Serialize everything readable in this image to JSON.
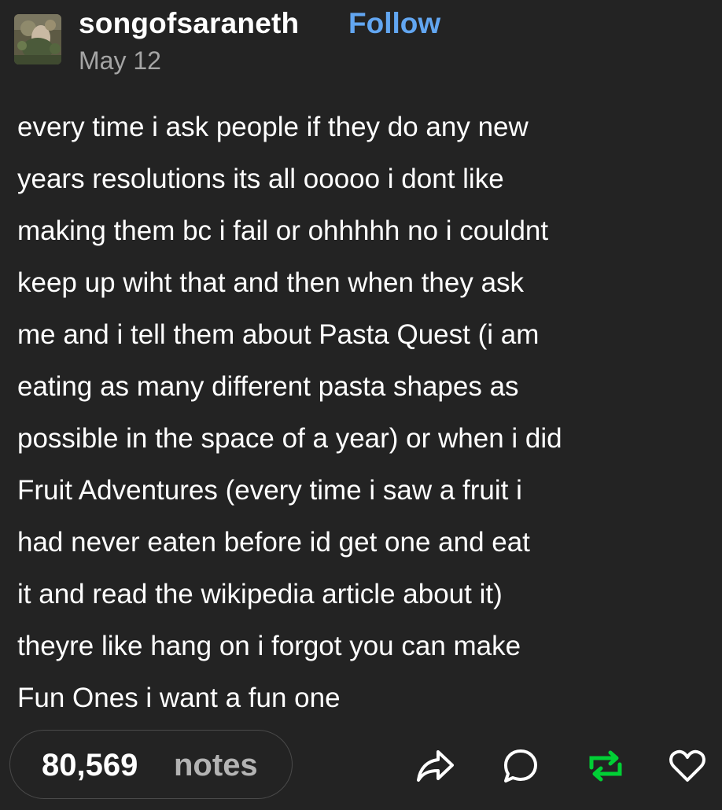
{
  "post": {
    "username": "songofsaraneth",
    "follow_label": "Follow",
    "date": "May 12",
    "body_lines": [
      "every time i ask people if they do any new",
      "years resolutions its all ooooo i dont like",
      "making them bc i fail or ohhhhh no i couldnt",
      "keep up wiht that and then when they ask",
      "me and i tell them about Pasta Quest (i am",
      "eating as many different pasta shapes as",
      "possible in the space of a year) or when i did",
      "Fruit Adventures (every time i saw a fruit i",
      "had never eaten before id get one and eat",
      "it and read the wikipedia article about it)",
      "theyre like hang on i forgot you can make",
      "Fun Ones i want a fun one"
    ]
  },
  "footer": {
    "notes_count": "80,569",
    "notes_label": "notes",
    "icons": [
      "share-icon",
      "reply-icon",
      "reblog-icon",
      "like-icon"
    ]
  },
  "colors": {
    "background": "#232323",
    "follow": "#62a6f1",
    "reblog": "#01cf35",
    "muted_text": "#a5a5a5"
  }
}
